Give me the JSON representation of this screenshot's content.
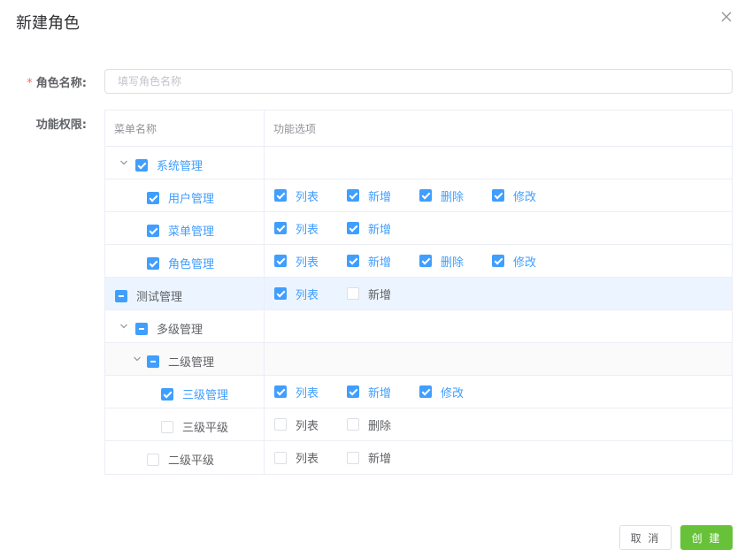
{
  "dialog": {
    "title": "新建角色"
  },
  "form": {
    "required_mark": "*",
    "name_label": "角色名称:",
    "name_placeholder": "填写角色名称",
    "name_value": "",
    "perm_label": "功能权限:"
  },
  "table": {
    "col_menu": "菜单名称",
    "col_ops": "功能选项",
    "rows": [
      {
        "name": "系统管理",
        "state": "checked",
        "expanded": true,
        "level": 1,
        "ops": []
      },
      {
        "name": "用户管理",
        "state": "checked",
        "level": 2,
        "ops": [
          {
            "label": "列表",
            "checked": true
          },
          {
            "label": "新增",
            "checked": true
          },
          {
            "label": "删除",
            "checked": true
          },
          {
            "label": "修改",
            "checked": true
          }
        ]
      },
      {
        "name": "菜单管理",
        "state": "checked",
        "level": 2,
        "ops": [
          {
            "label": "列表",
            "checked": true
          },
          {
            "label": "新增",
            "checked": true
          }
        ]
      },
      {
        "name": "角色管理",
        "state": "checked",
        "level": 2,
        "ops": [
          {
            "label": "列表",
            "checked": true
          },
          {
            "label": "新增",
            "checked": true
          },
          {
            "label": "删除",
            "checked": true
          },
          {
            "label": "修改",
            "checked": true
          }
        ]
      },
      {
        "name": "测试管理",
        "state": "indeterminate",
        "level": 0,
        "highlighted": true,
        "ops": [
          {
            "label": "列表",
            "checked": true
          },
          {
            "label": "新增",
            "checked": false
          }
        ]
      },
      {
        "name": "多级管理",
        "state": "indeterminate",
        "expanded": true,
        "level": 1,
        "ops": []
      },
      {
        "name": "二级管理",
        "state": "indeterminate",
        "expanded": true,
        "level": 2,
        "ops": []
      },
      {
        "name": "三级管理",
        "state": "checked",
        "level": 3,
        "ops": [
          {
            "label": "列表",
            "checked": true
          },
          {
            "label": "新增",
            "checked": true
          },
          {
            "label": "修改",
            "checked": true
          }
        ]
      },
      {
        "name": "三级平级",
        "state": "unchecked",
        "level": 3,
        "ops": [
          {
            "label": "列表",
            "checked": false
          },
          {
            "label": "删除",
            "checked": false
          }
        ]
      },
      {
        "name": "二级平级",
        "state": "unchecked",
        "level": 2,
        "ops": [
          {
            "label": "列表",
            "checked": false
          },
          {
            "label": "新增",
            "checked": false
          }
        ]
      }
    ]
  },
  "footer": {
    "cancel_label": "取 消",
    "create_label": "创 建"
  },
  "colors": {
    "primary": "#409eff",
    "success": "#67c23a",
    "danger": "#f56c6c",
    "highlight_row": "#ecf5ff"
  },
  "icons": {
    "close": "close-icon",
    "expand": "chevron-down-icon"
  }
}
